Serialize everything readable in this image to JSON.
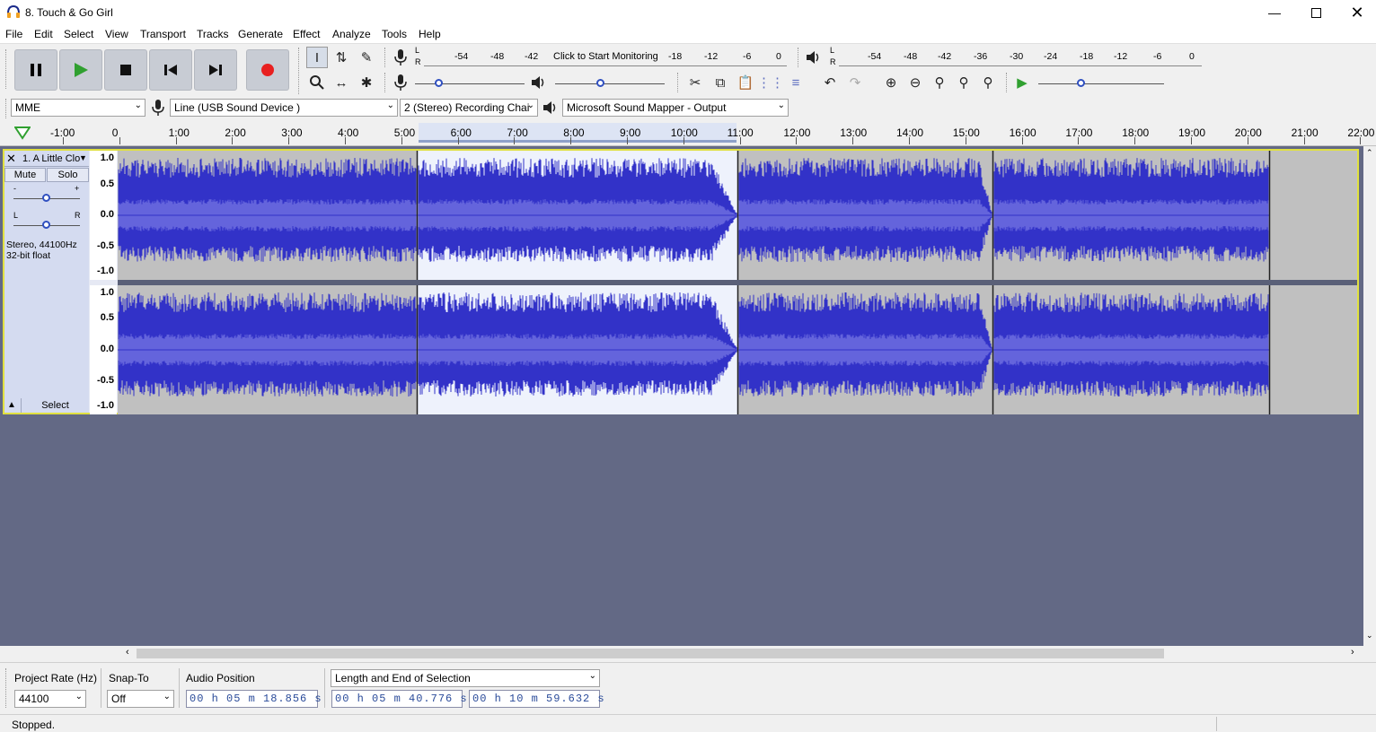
{
  "window": {
    "title": "8. Touch & Go Girl",
    "controls": [
      "minimize",
      "maximize",
      "close"
    ]
  },
  "menu": [
    "File",
    "Edit",
    "Select",
    "View",
    "Transport",
    "Tracks",
    "Generate",
    "Effect",
    "Analyze",
    "Tools",
    "Help"
  ],
  "transport": {
    "buttons": [
      "pause-icon",
      "play-icon",
      "stop-icon",
      "skip-start-icon",
      "skip-end-icon",
      "record-icon"
    ],
    "record_color": "#e82020",
    "play_color": "#30a030"
  },
  "meters": {
    "record_scale": [
      "-54",
      "-48",
      "-42",
      "Click to Start Monitoring",
      "-18",
      "-12",
      "-6",
      "0"
    ],
    "playback_scale": [
      "-54",
      "-48",
      "-42",
      "-36",
      "-30",
      "-24",
      "-18",
      "-12",
      "-6",
      "0"
    ],
    "channel_labels": [
      "L",
      "R"
    ]
  },
  "devices": {
    "host": "MME",
    "input": "Line (USB Sound Device       )",
    "channels": "2 (Stereo) Recording Chai",
    "output": "Microsoft Sound Mapper - Output"
  },
  "ruler": {
    "ticks": [
      "-1:00",
      "0",
      "1:00",
      "2:00",
      "3:00",
      "4:00",
      "5:00",
      "6:00",
      "7:00",
      "8:00",
      "9:00",
      "10:00",
      "11:00",
      "12:00",
      "13:00",
      "14:00",
      "15:00",
      "16:00",
      "17:00",
      "18:00",
      "19:00",
      "20:00",
      "21:00",
      "22:00"
    ]
  },
  "track": {
    "name": "1. A Little Clo",
    "mute_label": "Mute",
    "solo_label": "Solo",
    "gain_minus": "-",
    "gain_plus": "+",
    "pan_left": "L",
    "pan_right": "R",
    "info_line1": "Stereo, 44100Hz",
    "info_line2": "32-bit float",
    "select_label": "Select",
    "scale": [
      "1.0",
      "0.5",
      "0.0",
      "-0.5",
      "-1.0"
    ],
    "waveform_color": "#3232c8",
    "waveform_rms_color": "#6464dc",
    "selection_color": "#ffffff"
  },
  "selection_toolbar": {
    "project_rate_label": "Project Rate (Hz)",
    "project_rate_value": "44100",
    "snap_to_label": "Snap-To",
    "snap_to_value": "Off",
    "audio_position_label": "Audio Position",
    "audio_position_value": "00 h 05 m 18.856 s",
    "selection_mode": "Length and End of Selection",
    "selection_length": "00 h 05 m 40.776 s",
    "selection_end": "00 h 10 m 59.632 s"
  },
  "status": "Stopped."
}
